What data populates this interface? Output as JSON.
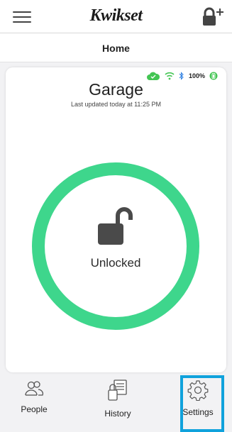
{
  "header": {
    "logo_text": "Kwikset",
    "menu_icon": "hamburger-menu-icon",
    "add_lock_icon": "add-lock-icon"
  },
  "subheader": {
    "title": "Home"
  },
  "lock": {
    "name": "Garage",
    "last_updated": "Last updated today at 11:25 PM",
    "state": "Unlocked",
    "battery": "100%",
    "status_icons": [
      "cloud-check-icon",
      "wifi-icon",
      "bluetooth-icon",
      "battery-icon"
    ]
  },
  "nav": {
    "people_label": "People",
    "history_label": "History",
    "settings_label": "Settings"
  },
  "colors": {
    "ring": "#3ed68c",
    "status_green": "#43c553",
    "bluetooth": "#2a7de1",
    "highlight": "#10a2dc",
    "padlock": "#4a4a4a"
  }
}
